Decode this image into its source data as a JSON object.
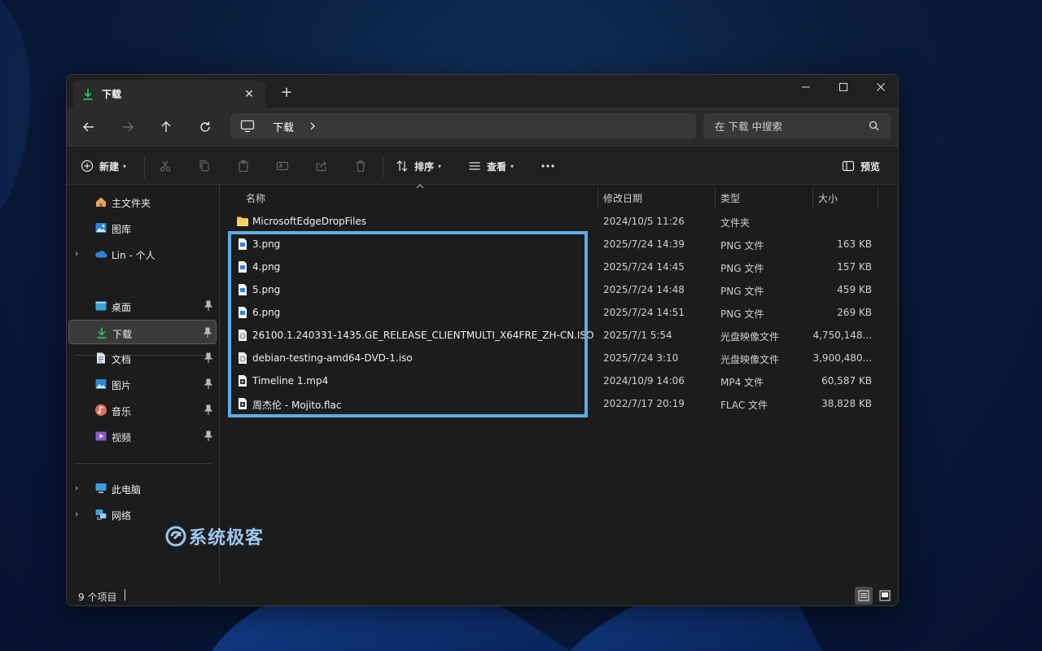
{
  "window": {
    "tab_title": "下载",
    "controls": {
      "minimize": "minimize-icon",
      "maximize": "maximize-icon",
      "close": "close-icon"
    }
  },
  "address": {
    "crumb": "下载",
    "search_placeholder": "在 下载 中搜索"
  },
  "toolbar": {
    "new_label": "新建",
    "sort_label": "排序",
    "view_label": "查看",
    "preview_label": "预览"
  },
  "sidebar": {
    "items": [
      {
        "label": "主文件夹",
        "icon": "home-icon"
      },
      {
        "label": "图库",
        "icon": "gallery-icon"
      },
      {
        "label": "Lin - 个人",
        "icon": "onedrive-icon"
      },
      {
        "label": "桌面",
        "icon": "desktop-icon",
        "pinned": true
      },
      {
        "label": "下载",
        "icon": "download-icon",
        "pinned": true,
        "selected": true
      },
      {
        "label": "文档",
        "icon": "documents-icon",
        "pinned": true
      },
      {
        "label": "图片",
        "icon": "pictures-icon",
        "pinned": true
      },
      {
        "label": "音乐",
        "icon": "music-icon",
        "pinned": true
      },
      {
        "label": "视频",
        "icon": "videos-icon",
        "pinned": true
      },
      {
        "label": "此电脑",
        "icon": "this-pc-icon"
      },
      {
        "label": "网络",
        "icon": "network-icon"
      }
    ]
  },
  "columns": {
    "name": "名称",
    "modified": "修改日期",
    "type": "类型",
    "size": "大小"
  },
  "files": [
    {
      "name": "MicrosoftEdgeDropFiles",
      "date": "2024/10/5 11:26",
      "type": "文件夹",
      "size": "",
      "icon": "folder-icon"
    },
    {
      "name": "3.png",
      "date": "2025/7/24 14:39",
      "type": "PNG 文件",
      "size": "163 KB",
      "icon": "image-file-icon"
    },
    {
      "name": "4.png",
      "date": "2025/7/24 14:45",
      "type": "PNG 文件",
      "size": "157 KB",
      "icon": "image-file-icon"
    },
    {
      "name": "5.png",
      "date": "2025/7/24 14:48",
      "type": "PNG 文件",
      "size": "459 KB",
      "icon": "image-file-icon"
    },
    {
      "name": "6.png",
      "date": "2025/7/24 14:51",
      "type": "PNG 文件",
      "size": "269 KB",
      "icon": "image-file-icon"
    },
    {
      "name": "26100.1.240331-1435.GE_RELEASE_CLIENTMULTI_X64FRE_ZH-CN.ISO",
      "date": "2025/7/1 5:54",
      "type": "光盘映像文件",
      "size": "4,750,148...",
      "icon": "disc-image-icon"
    },
    {
      "name": "debian-testing-amd64-DVD-1.iso",
      "date": "2025/7/24 3:10",
      "type": "光盘映像文件",
      "size": "3,900,480...",
      "icon": "disc-image-icon"
    },
    {
      "name": "Timeline 1.mp4",
      "date": "2024/10/9 14:06",
      "type": "MP4 文件",
      "size": "60,587 KB",
      "icon": "video-file-icon"
    },
    {
      "name": "周杰伦 - Mojito.flac",
      "date": "2022/7/17 20:19",
      "type": "FLAC 文件",
      "size": "38,828 KB",
      "icon": "audio-file-icon"
    }
  ],
  "status": {
    "count": "9 个项目"
  },
  "watermark": {
    "text": "系统极客"
  },
  "colors": {
    "accent": "#5aaee6",
    "window_bg": "#1c1c1c",
    "download_green": "#2fb56a"
  }
}
